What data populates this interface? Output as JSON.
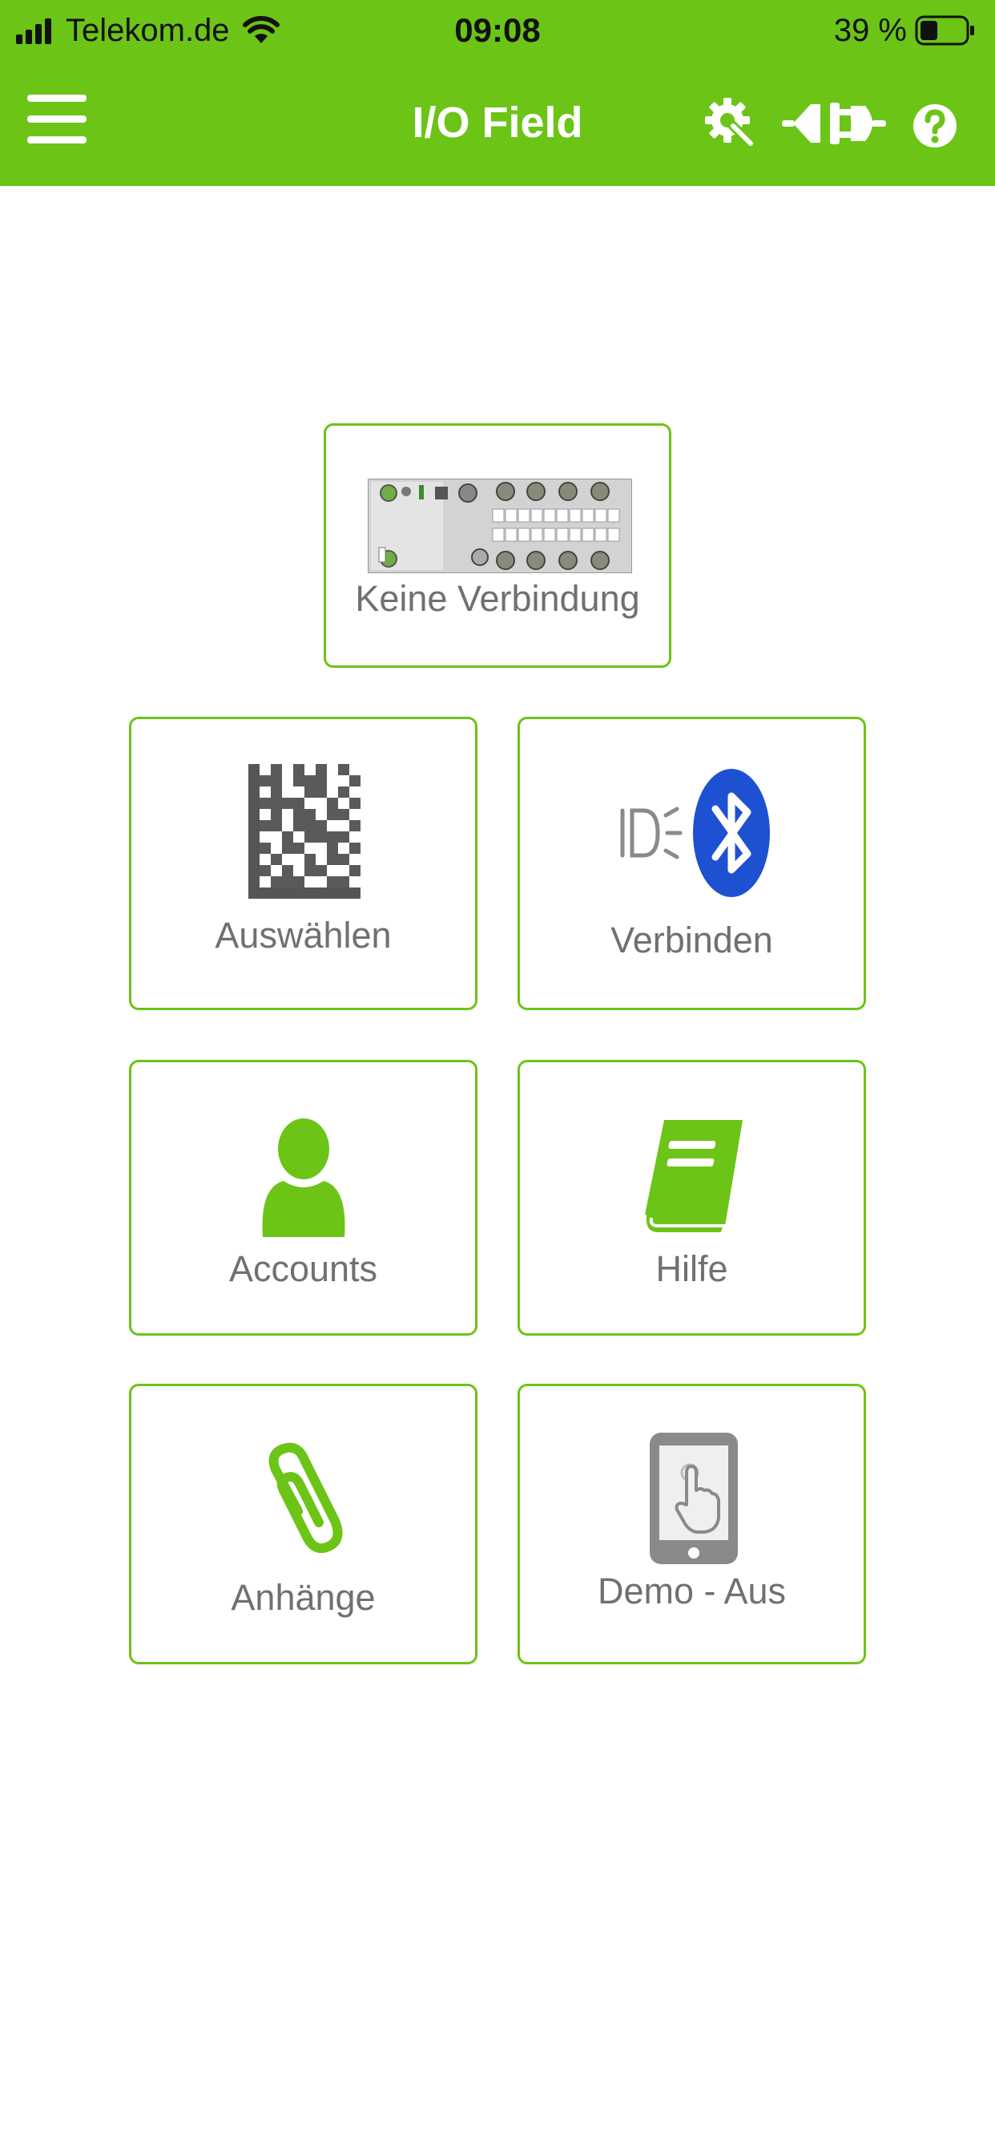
{
  "status_bar": {
    "carrier": "Telekom.de",
    "time": "09:08",
    "battery_percent": "39 %",
    "battery_level": 0.39
  },
  "app_bar": {
    "title": "I/O Field",
    "icons": [
      "menu-icon",
      "settings-gear-icon",
      "connect-plug-icon",
      "help-icon"
    ]
  },
  "colors": {
    "brand_green": "#6cc417",
    "label_gray": "#707070",
    "bluetooth_blue": "#1e50d2"
  },
  "device_tile": {
    "label": "Keine Verbindung",
    "icon": "io-module-device-image"
  },
  "tiles": {
    "select": {
      "label": "Auswählen",
      "icon": "datamatrix-code-icon"
    },
    "connect": {
      "label": "Verbinden",
      "icon": "bluetooth-icon"
    },
    "accounts": {
      "label": "Accounts",
      "icon": "user-icon"
    },
    "help": {
      "label": "Hilfe",
      "icon": "book-icon"
    },
    "attachments": {
      "label": "Anhänge",
      "icon": "paperclip-icon"
    },
    "demo": {
      "label": "Demo - Aus",
      "icon": "tablet-touch-icon"
    }
  }
}
